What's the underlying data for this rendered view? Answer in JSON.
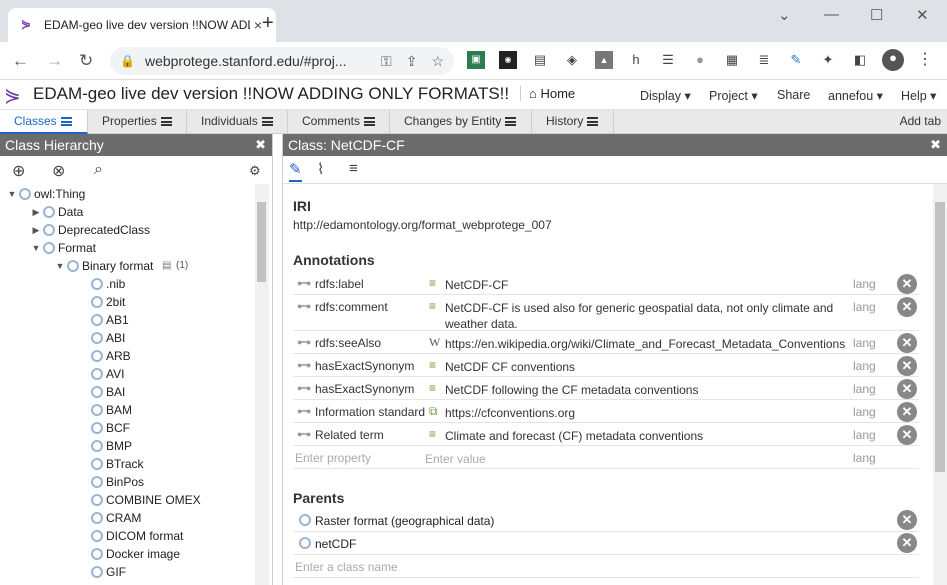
{
  "browser": {
    "tab_title": "EDAM-geo live dev version !!NOW ADDING ONLY FORMATS!!",
    "url": "webprotege.stanford.edu/#proj...",
    "newtab": "+",
    "close_tab": "×"
  },
  "app": {
    "title": "EDAM-geo live dev version !!NOW ADDING ONLY FORMATS!!",
    "home": "Home",
    "menus": [
      "Display ▾",
      "Project ▾",
      "Share",
      "annefou ▾",
      "Help ▾"
    ]
  },
  "tabs": [
    {
      "label": "Classes",
      "active": true
    },
    {
      "label": "Properties"
    },
    {
      "label": "Individuals"
    },
    {
      "label": "Comments"
    },
    {
      "label": "Changes by Entity"
    },
    {
      "label": "History"
    }
  ],
  "add_tab": "Add tab",
  "left_panel": {
    "title": "Class Hierarchy",
    "tree": [
      {
        "label": "owl:Thing",
        "level": 0,
        "toggle": "expanded"
      },
      {
        "label": "Data",
        "level": 1,
        "toggle": "collapsed"
      },
      {
        "label": "DeprecatedClass",
        "level": 1,
        "toggle": "collapsed"
      },
      {
        "label": "Format",
        "level": 1,
        "toggle": "expanded"
      },
      {
        "label": "Binary format",
        "level": 2,
        "toggle": "expanded",
        "comments": "(1)"
      },
      {
        "label": ".nib",
        "level": 3
      },
      {
        "label": "2bit",
        "level": 3
      },
      {
        "label": "AB1",
        "level": 3
      },
      {
        "label": "ABI",
        "level": 3
      },
      {
        "label": "ARB",
        "level": 3
      },
      {
        "label": "AVI",
        "level": 3
      },
      {
        "label": "BAI",
        "level": 3
      },
      {
        "label": "BAM",
        "level": 3
      },
      {
        "label": "BCF",
        "level": 3
      },
      {
        "label": "BMP",
        "level": 3
      },
      {
        "label": "BTrack",
        "level": 3
      },
      {
        "label": "BinPos",
        "level": 3
      },
      {
        "label": "COMBINE OMEX",
        "level": 3
      },
      {
        "label": "CRAM",
        "level": 3
      },
      {
        "label": "DICOM format",
        "level": 3
      },
      {
        "label": "Docker image",
        "level": 3
      },
      {
        "label": "GIF",
        "level": 3
      }
    ]
  },
  "right_panel": {
    "title": "Class: NetCDF-CF",
    "iri_heading": "IRI",
    "iri": "http://edamontology.org/format_webprotege_007",
    "annotations_heading": "Annotations",
    "annotations": [
      {
        "property": "rdfs:label",
        "value": "NetCDF-CF",
        "lang": "lang",
        "vtype": "text"
      },
      {
        "property": "rdfs:comment",
        "value": "NetCDF-CF is used also for generic geospatial data, not only climate and weather data.",
        "lang": "lang",
        "vtype": "text"
      },
      {
        "property": "rdfs:seeAlso",
        "value": "https://en.wikipedia.org/wiki/Climate_and_Forecast_Metadata_Conventions",
        "lang": "lang",
        "vtype": "wiki"
      },
      {
        "property": "hasExactSynonym",
        "value": "NetCDF CF conventions",
        "lang": "lang",
        "vtype": "text"
      },
      {
        "property": "hasExactSynonym",
        "value": "NetCDF following the CF metadata conventions",
        "lang": "lang",
        "vtype": "text"
      },
      {
        "property": "Information standard",
        "value": "https://cfconventions.org",
        "lang": "lang",
        "vtype": "link"
      },
      {
        "property": "Related term",
        "value": "Climate and forecast (CF) metadata conventions",
        "lang": "lang",
        "vtype": "text"
      }
    ],
    "placeholder_property": "Enter property",
    "placeholder_value": "Enter value",
    "placeholder_lang": "lang",
    "parents_heading": "Parents",
    "parents": [
      "Raster format (geographical data)",
      "netCDF"
    ],
    "parents_placeholder": "Enter a class name"
  },
  "colors": {
    "accent": "#1a66c0",
    "panel_header": "#6c6c6c",
    "class_icon": "#9ab4d2"
  }
}
